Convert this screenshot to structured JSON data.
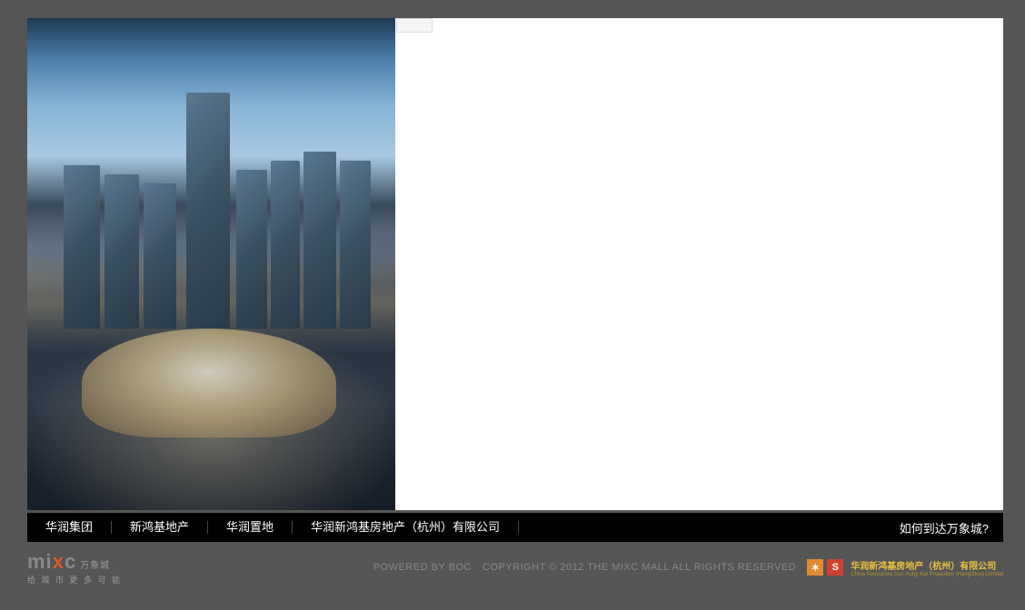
{
  "nav": {
    "links": [
      "华润集团",
      "新鸿基地产",
      "华润置地",
      "华润新鸿基房地产（杭州）有限公司"
    ],
    "right": "如何到达万象城?"
  },
  "footer": {
    "logo_main": "mixc",
    "logo_cn_top": "万象城",
    "logo_cn_sub": "给 城 市 更 多 可 能",
    "powered": "POWERED BY BOC",
    "copyright": "COPYRIGHT © 2012 THE MIXC MALL ALL RIGHTS RESERVED",
    "partner_line1": "华润新鸿基房地产（杭州）有限公司",
    "partner_line2": "China Resources Sun Hung Kai Properties (Hangzhou) Limited"
  }
}
